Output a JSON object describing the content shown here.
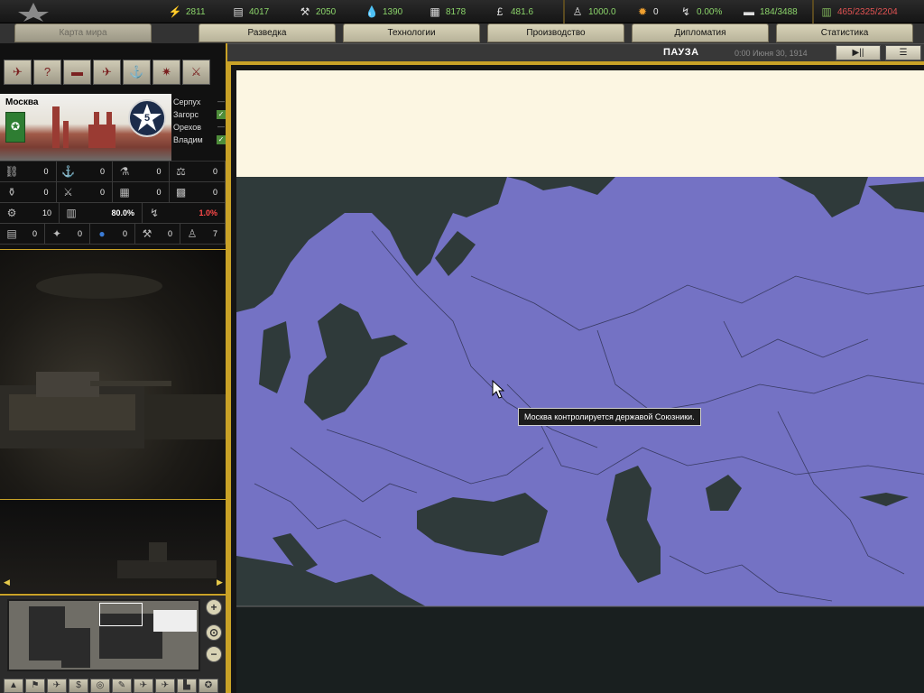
{
  "resources": [
    {
      "icon": "energy-icon",
      "value": "2811"
    },
    {
      "icon": "metal-icon",
      "value": "4017"
    },
    {
      "icon": "rare-materials-icon",
      "value": "2050"
    },
    {
      "icon": "oil-icon",
      "value": "1390"
    },
    {
      "icon": "supplies-icon",
      "value": "8178"
    },
    {
      "icon": "money-icon",
      "value": "481.6"
    }
  ],
  "stats": {
    "manpower": "1000.0",
    "nuclear": "0",
    "dissent": "0.00%",
    "transport": "184/3488",
    "ic": "465/2325/2204"
  },
  "tabs": [
    "Карта мира",
    "Разведка",
    "Технологии",
    "Производство",
    "Дипломатия",
    "Статистика"
  ],
  "status": {
    "pause_label": "ПАУЗА",
    "date": "0:00 Июня 30, 1914",
    "play_label": "▶||",
    "log_label": "☰"
  },
  "province": {
    "name": "Москва",
    "vp": "5",
    "neighbors": [
      {
        "name": "Серпух",
        "mark": "—"
      },
      {
        "name": "Загорс",
        "mark": "✓"
      },
      {
        "name": "Орехов",
        "mark": "—"
      },
      {
        "name": "Владим",
        "mark": "✓"
      }
    ],
    "rows": [
      [
        {
          "icon": "infrastructure-icon",
          "value": "0"
        },
        {
          "icon": "naval-base-icon",
          "value": "0"
        },
        {
          "icon": "research-icon",
          "value": "0"
        },
        {
          "icon": "air-base-icon",
          "value": "0"
        }
      ],
      [
        {
          "icon": "flask-icon",
          "value": "0"
        },
        {
          "icon": "aa-gun-icon",
          "value": "0"
        },
        {
          "icon": "fort-icon",
          "value": "0"
        },
        {
          "icon": "coastal-fort-icon",
          "value": "0"
        }
      ],
      [
        {
          "icon": "factory-icon",
          "value": "10"
        },
        {
          "icon": "industry-icon",
          "value": "80.0%"
        },
        {
          "icon": "resistance-icon",
          "value": "1.0%"
        }
      ],
      [
        {
          "icon": "metal-icon",
          "value": "0"
        },
        {
          "icon": "energy-icon",
          "value": "0"
        },
        {
          "icon": "oil-icon",
          "value": "0"
        },
        {
          "icon": "rare-icon",
          "value": "0"
        },
        {
          "icon": "manpower-icon",
          "value": "7"
        }
      ]
    ]
  },
  "map": {
    "tooltip": "Москва контролируется державой Союзники."
  },
  "colors": {
    "accent": "#c9a227",
    "land": "#7472c4",
    "sea": "#2f3a3a"
  }
}
